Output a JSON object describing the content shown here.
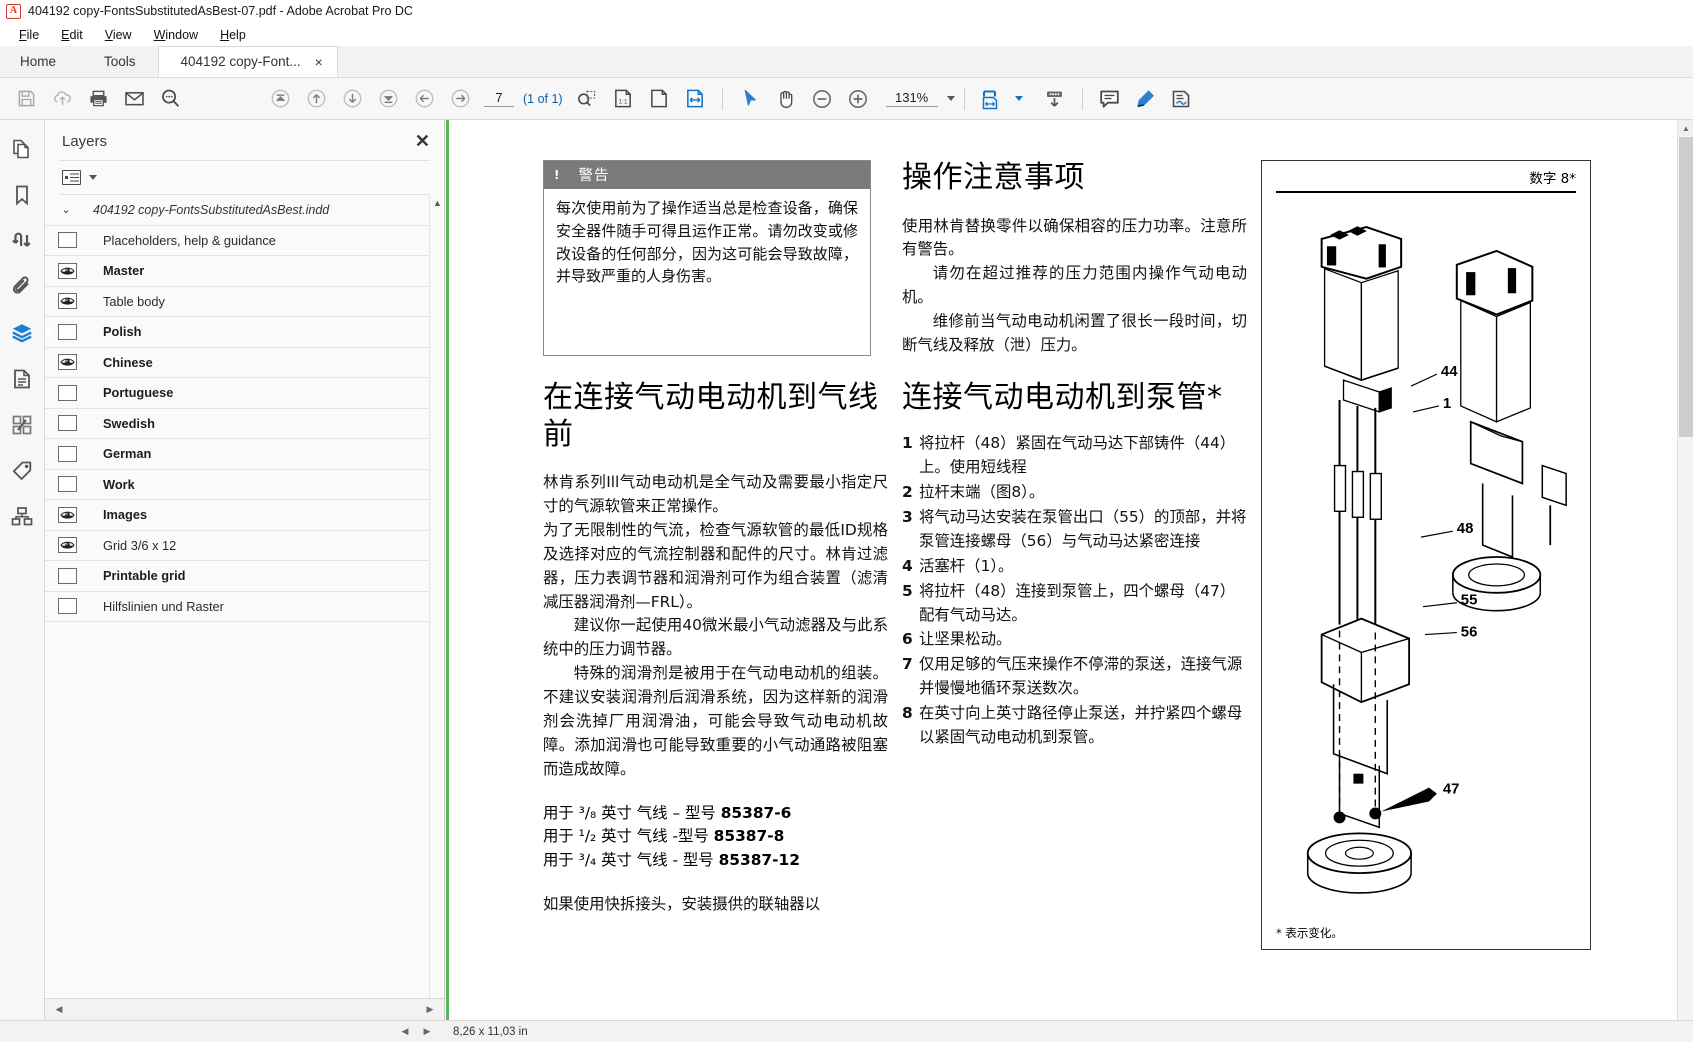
{
  "window": {
    "title": "404192 copy-FontsSubstitutedAsBest-07.pdf - Adobe Acrobat Pro DC",
    "app_icon": "acrobat-logo-icon"
  },
  "menubar": {
    "items": [
      {
        "label": "File"
      },
      {
        "label": "Edit"
      },
      {
        "label": "View"
      },
      {
        "label": "Window"
      },
      {
        "label": "Help"
      }
    ]
  },
  "tabs": {
    "home": "Home",
    "tools": "Tools",
    "document": "404192 copy-Font...",
    "close_glyph": "×"
  },
  "toolbar": {
    "left_icons": [
      "save-icon",
      "upload-cloud-icon",
      "print-icon",
      "email-icon",
      "search-icon"
    ],
    "nav_icons": [
      "first-page-icon",
      "previous-page-icon",
      "next-page-icon",
      "last-page-icon",
      "back-icon",
      "forward-icon"
    ],
    "page_number": "7",
    "page_of": "(1 of 1)",
    "view_icons": [
      "zoom-selection-icon",
      "actual-size-icon",
      "fit-page-icon",
      "fit-width-icon"
    ],
    "tool_icons": [
      "select-tool-icon",
      "hand-tool-icon",
      "zoom-out-icon",
      "zoom-in-icon"
    ],
    "zoom_level": "131%",
    "right_icons": [
      "page-display-icon",
      "scroll-down-icon",
      "comment-icon",
      "highlight-icon",
      "sign-icon"
    ]
  },
  "rail": {
    "items": [
      {
        "name": "page-thumbnails",
        "icon": "pages-icon",
        "active": false
      },
      {
        "name": "bookmarks",
        "icon": "bookmark-icon",
        "active": false
      },
      {
        "name": "page-order",
        "icon": "reorder-icon",
        "active": false
      },
      {
        "name": "attachments",
        "icon": "paperclip-icon",
        "active": false
      },
      {
        "name": "layers",
        "icon": "layers-icon",
        "active": true
      },
      {
        "name": "content",
        "icon": "content-document-icon",
        "active": false
      },
      {
        "name": "accessibility-tags",
        "icon": "tags-grid-icon",
        "active": false
      },
      {
        "name": "destinations",
        "icon": "destination-tag-icon",
        "active": false
      },
      {
        "name": "model-tree",
        "icon": "model-tree-icon",
        "active": false
      }
    ]
  },
  "panel": {
    "title": "Layers",
    "close_glyph": "✕",
    "options_icon": "list-options-icon",
    "document_node": "404192 copy-FontsSubstitutedAsBest.indd",
    "expand_glyph": "⌄",
    "layers": [
      {
        "label": "Placeholders, help & guidance",
        "visible": false,
        "bold": false
      },
      {
        "label": "Master",
        "visible": true,
        "bold": true
      },
      {
        "label": "Table body",
        "visible": true,
        "bold": false
      },
      {
        "label": "Polish",
        "visible": false,
        "bold": true
      },
      {
        "label": "Chinese",
        "visible": true,
        "bold": true
      },
      {
        "label": "Portuguese",
        "visible": false,
        "bold": true
      },
      {
        "label": "Swedish",
        "visible": false,
        "bold": true
      },
      {
        "label": "German",
        "visible": false,
        "bold": true
      },
      {
        "label": "Work",
        "visible": false,
        "bold": true
      },
      {
        "label": "Images",
        "visible": true,
        "bold": true
      },
      {
        "label": "Grid 3/6 x 12",
        "visible": true,
        "bold": false
      },
      {
        "label": "Printable grid",
        "visible": false,
        "bold": true
      },
      {
        "label": "Hilfslinien und Raster",
        "visible": false,
        "bold": false
      }
    ]
  },
  "document": {
    "warning": {
      "marker": "!",
      "heading": "警告",
      "body": "每次使用前为了操作适当总是检查设备，确保安全器件随手可得且运作正常。请勿改变或修改设备的任何部分，因为这可能会导致故障，并导致严重的人身伤害。"
    },
    "left_column": {
      "heading": "在连接气动电动机到气线前",
      "paragraphs": [
        "林肯系列Ill气动电动机是全气动及需要最小指定尺寸的气源软管来正常操作。",
        "为了无限制性的气流，检查气源软管的最低ID规格及选择对应的气流控制器和配件的尺寸。林肯过滤器，压力表调节器和润滑剂可作为组合装置（滤清减压器润滑剂—FRL）。",
        "建议你一起使用40微米最小气动滤器及与此系统中的压力调节器。",
        "特殊的润滑剂是被用于在气动电动机的组装。不建议安装润滑剂后润滑系统，因为这样新的润滑剂会洗掉厂用润滑油，可能会导致气动电动机故障。添加润滑也可能导致重要的小气动通路被阻塞而造成故障。"
      ],
      "part_numbers": [
        {
          "text": "用于 ³/₈ 英寸 气线 – 型号 ",
          "number": "85387-6"
        },
        {
          "text": "用于 ¹/₂ 英寸 气线 -型号 ",
          "number": "85387-8"
        },
        {
          "text": "用于 ³/₄ 英寸 气线 - 型号 ",
          "number": "85387-12"
        }
      ],
      "trailing": "如果使用快拆接头，安装摄供的联轴器以"
    },
    "right_column": {
      "heading": "操作注意事项",
      "paragraphs": [
        "使用林肯替换零件以确保相容的压力功率。注意所有警告。",
        "请勿在超过推荐的压力范围内操作气动电动机。",
        "维修前当气动电动机闲置了很长一段时间，切断气线及释放（泄）压力。"
      ],
      "heading2": "连接气动电动机到泵管*",
      "steps": [
        {
          "num": "1",
          "text": "将拉杆（48）紧固在气动马达下部铸件（44）上。使用短线程"
        },
        {
          "num": "2",
          "text": "拉杆末端（图8）。"
        },
        {
          "num": "3",
          "text": "将气动马达安装在泵管出口（55）的顶部，并将泵管连接螺母（56）与气动马达紧密连接"
        },
        {
          "num": "4",
          "text": "活塞杆（1）。"
        },
        {
          "num": "5",
          "text": "将拉杆（48）连接到泵管上，四个螺母（47）配有气动马达。"
        },
        {
          "num": "6",
          "text": "让坚果松动。"
        },
        {
          "num": "7",
          "text": "仅用足够的气压来操作不停滞的泵送，连接气源并慢慢地循环泵送数次。"
        },
        {
          "num": "8",
          "text": "在英寸向上英寸路径停止泵送，并拧紧四个螺母以紧固气动电动机到泵管。"
        }
      ]
    },
    "figure": {
      "label": "数字 8*",
      "footnote": "*  表示变化。",
      "callouts": [
        "44",
        "1",
        "48",
        "55",
        "56",
        "47"
      ]
    }
  },
  "statusbar": {
    "dimensions": "8,26 x 11,03 in"
  },
  "colors": {
    "accent_blue": "#1473c6",
    "page_edge_green": "#57b957",
    "warn_gray": "#7a7a7a",
    "panel_bg": "#fafafa",
    "toolbar_bg": "#f7f7f7"
  }
}
